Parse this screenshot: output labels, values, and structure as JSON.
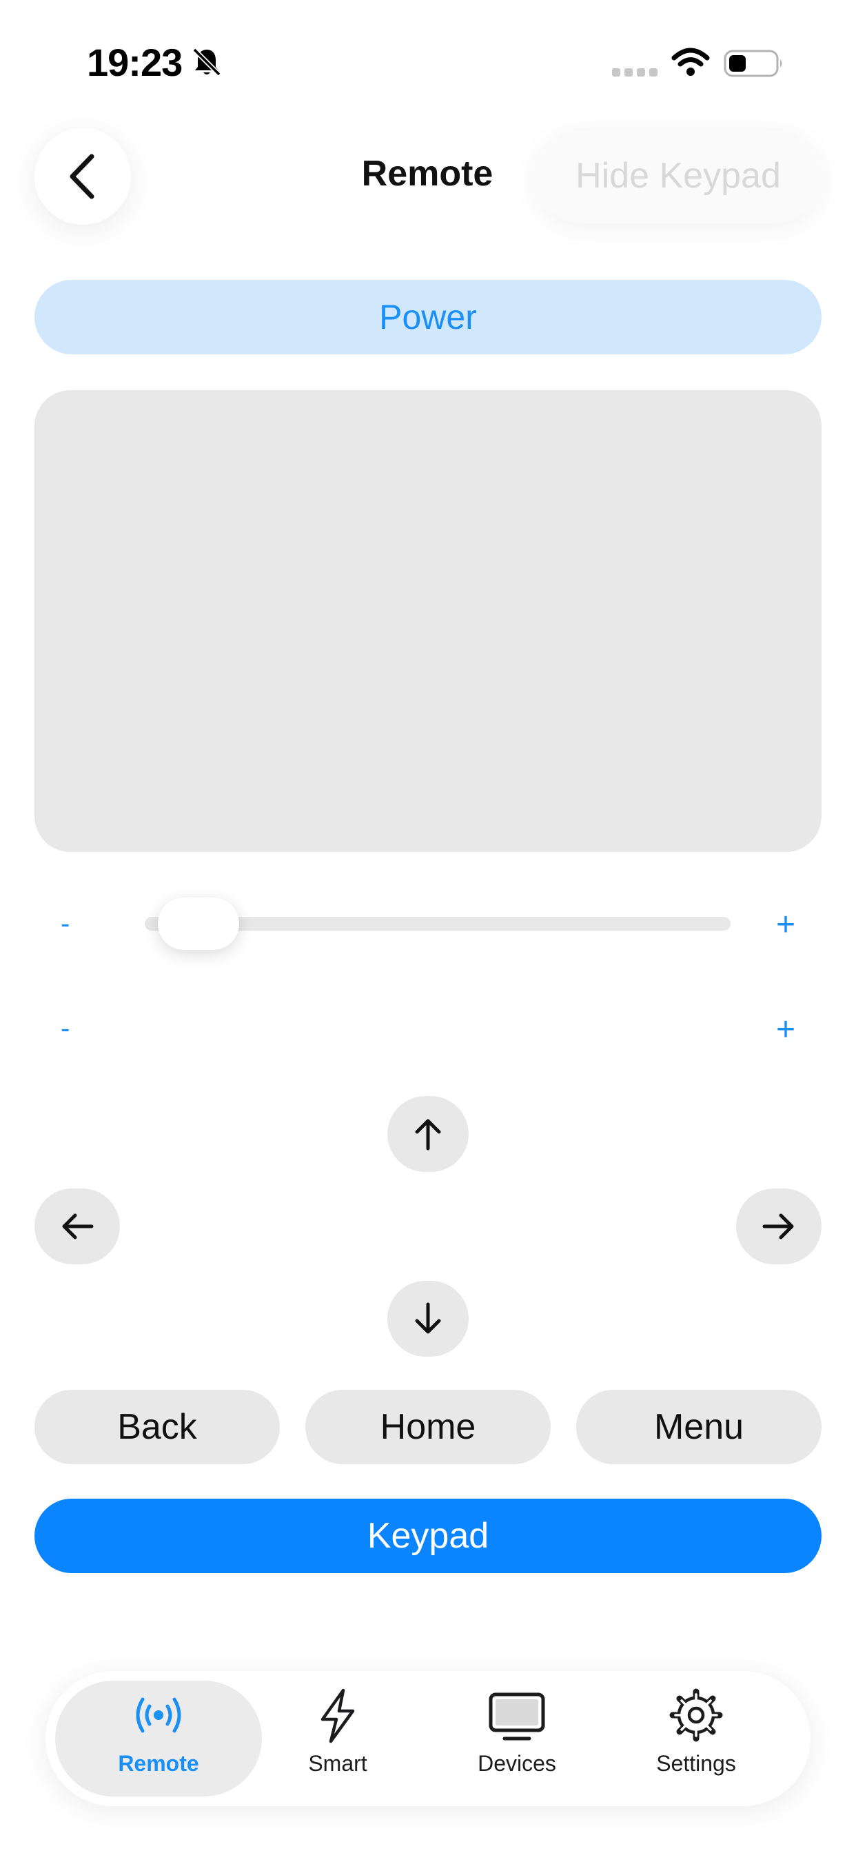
{
  "status_bar": {
    "time": "19:23",
    "icons": [
      "bell-slash-icon",
      "cellular-signal-icon",
      "wifi-icon",
      "battery-icon"
    ]
  },
  "header": {
    "back_icon": "chevron-left-icon",
    "title": "Remote",
    "hide_keypad_label": "Hide Keypad"
  },
  "power_label": "Power",
  "volume_slider": {
    "minus": "-",
    "plus": "+",
    "value": 0.06
  },
  "channel_row": {
    "minus": "-",
    "plus": "+"
  },
  "dpad": {
    "up_icon": "arrow-up-icon",
    "left_icon": "arrow-left-icon",
    "right_icon": "arrow-right-icon",
    "down_icon": "arrow-down-icon"
  },
  "buttons": {
    "back": "Back",
    "home": "Home",
    "menu": "Menu",
    "keypad": "Keypad"
  },
  "tabs": [
    {
      "label": "Remote",
      "icon": "antenna-broadcast-icon",
      "active": true
    },
    {
      "label": "Smart",
      "icon": "bolt-icon",
      "active": false
    },
    {
      "label": "Devices",
      "icon": "tv-icon",
      "active": false
    },
    {
      "label": "Settings",
      "icon": "gear-icon",
      "active": false
    }
  ],
  "colors": {
    "accent": "#0A84FF",
    "accent_text": "#1A8FF6",
    "power_bg": "#D1E8FC",
    "control_bg": "#E8E8E8"
  }
}
